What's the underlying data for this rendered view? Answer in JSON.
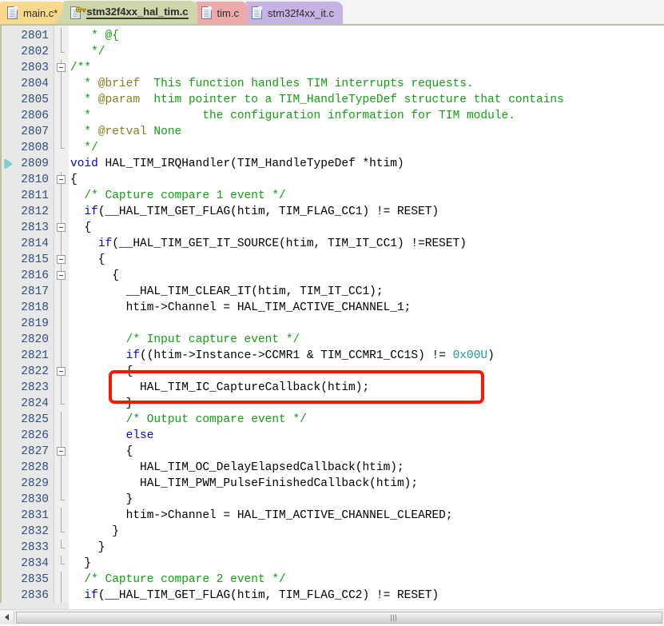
{
  "window": {
    "title": "stm32f4xx_hal_tim.c",
    "accent_green": "#cdd7ab",
    "annotation_color": "#ff1500"
  },
  "tabs": [
    {
      "label": "main.c*",
      "icon": "file-icon",
      "color": "#fbd98c",
      "active": false,
      "modified": true,
      "locked": false
    },
    {
      "label": "stm32f4xx_hal_tim.c",
      "icon": "file-icon",
      "color": "#cdd7ab",
      "active": true,
      "modified": false,
      "locked": true,
      "lock_icon": "key-icon"
    },
    {
      "label": "tim.c",
      "icon": "file-icon",
      "color": "#edaaaa",
      "active": false,
      "modified": false,
      "locked": false
    },
    {
      "label": "stm32f4xx_it.c",
      "icon": "file-icon",
      "color": "#c5b4e3",
      "active": false,
      "modified": false,
      "locked": false
    }
  ],
  "editor": {
    "first_line": 2801,
    "marker_line": 2809,
    "marker_icon": "bookmark-arrow-icon",
    "colors": {
      "keyword": "#0000e6",
      "comment": "#11a011",
      "doxygen_tag": "#8a7a1f",
      "number": "#1b9a9a",
      "text": "#000000",
      "line_number": "#2f4f7f",
      "gutter_bg": "#e8e8e8"
    },
    "lines": [
      {
        "n": 2801,
        "fold": "line",
        "tokens": [
          {
            "t": "   * @{",
            "c": "cmt"
          }
        ]
      },
      {
        "n": 2802,
        "fold": "end",
        "tokens": [
          {
            "t": "   */",
            "c": "cmt"
          }
        ]
      },
      {
        "n": 2803,
        "fold": "box",
        "tokens": [
          {
            "t": "/**",
            "c": "cmt"
          }
        ]
      },
      {
        "n": 2804,
        "fold": "line",
        "tokens": [
          {
            "t": "  * ",
            "c": "cmt"
          },
          {
            "t": "@brief",
            "c": "dox"
          },
          {
            "t": "  This function handles TIM interrupts requests.",
            "c": "cmt"
          }
        ]
      },
      {
        "n": 2805,
        "fold": "line",
        "tokens": [
          {
            "t": "  * ",
            "c": "cmt"
          },
          {
            "t": "@param",
            "c": "dox"
          },
          {
            "t": "  htim pointer to a TIM_HandleTypeDef structure that contains",
            "c": "cmt"
          }
        ]
      },
      {
        "n": 2806,
        "fold": "line",
        "tokens": [
          {
            "t": "  *                the configuration information for TIM module.",
            "c": "cmt"
          }
        ]
      },
      {
        "n": 2807,
        "fold": "line",
        "tokens": [
          {
            "t": "  * ",
            "c": "cmt"
          },
          {
            "t": "@retval",
            "c": "dox"
          },
          {
            "t": " None",
            "c": "cmt"
          }
        ]
      },
      {
        "n": 2808,
        "fold": "end",
        "tokens": [
          {
            "t": "  */",
            "c": "cmt"
          }
        ]
      },
      {
        "n": 2809,
        "fold": "none",
        "marker": true,
        "tokens": [
          {
            "t": "void",
            "c": "kw"
          },
          {
            "t": " HAL_TIM_IRQHandler(TIM_HandleTypeDef *htim)",
            "c": ""
          }
        ]
      },
      {
        "n": 2810,
        "fold": "box",
        "tokens": [
          {
            "t": "{",
            "c": ""
          }
        ]
      },
      {
        "n": 2811,
        "fold": "line",
        "tokens": [
          {
            "t": "  /* Capture compare 1 event */",
            "c": "cmt"
          }
        ]
      },
      {
        "n": 2812,
        "fold": "line",
        "tokens": [
          {
            "t": "  ",
            "c": ""
          },
          {
            "t": "if",
            "c": "kw"
          },
          {
            "t": "(__HAL_TIM_GET_FLAG(htim, TIM_FLAG_CC1) != RESET)",
            "c": ""
          }
        ]
      },
      {
        "n": 2813,
        "fold": "box",
        "tokens": [
          {
            "t": "  {",
            "c": ""
          }
        ]
      },
      {
        "n": 2814,
        "fold": "line",
        "tokens": [
          {
            "t": "    ",
            "c": ""
          },
          {
            "t": "if",
            "c": "kw"
          },
          {
            "t": "(__HAL_TIM_GET_IT_SOURCE(htim, TIM_IT_CC1) !=RESET)",
            "c": ""
          }
        ]
      },
      {
        "n": 2815,
        "fold": "box",
        "tokens": [
          {
            "t": "    {",
            "c": ""
          }
        ]
      },
      {
        "n": 2816,
        "fold": "box",
        "tokens": [
          {
            "t": "      {",
            "c": ""
          }
        ]
      },
      {
        "n": 2817,
        "fold": "line",
        "tokens": [
          {
            "t": "        __HAL_TIM_CLEAR_IT(htim, TIM_IT_CC1);",
            "c": ""
          }
        ]
      },
      {
        "n": 2818,
        "fold": "line",
        "tokens": [
          {
            "t": "        htim->Channel = HAL_TIM_ACTIVE_CHANNEL_1;",
            "c": ""
          }
        ]
      },
      {
        "n": 2819,
        "fold": "line",
        "tokens": [
          {
            "t": "",
            "c": ""
          }
        ]
      },
      {
        "n": 2820,
        "fold": "line",
        "tokens": [
          {
            "t": "        /* Input capture event */",
            "c": "cmt"
          }
        ]
      },
      {
        "n": 2821,
        "fold": "line",
        "tokens": [
          {
            "t": "        ",
            "c": ""
          },
          {
            "t": "if",
            "c": "kw"
          },
          {
            "t": "((htim->Instance->CCMR1 & TIM_CCMR1_CC1S) != ",
            "c": ""
          },
          {
            "t": "0x00U",
            "c": "num"
          },
          {
            "t": ")",
            "c": ""
          }
        ]
      },
      {
        "n": 2822,
        "fold": "box",
        "tokens": [
          {
            "t": "        {",
            "c": ""
          }
        ]
      },
      {
        "n": 2823,
        "fold": "line",
        "tokens": [
          {
            "t": "          HAL_TIM_IC_CaptureCallback(htim);",
            "c": ""
          }
        ]
      },
      {
        "n": 2824,
        "fold": "end",
        "tokens": [
          {
            "t": "        }",
            "c": ""
          }
        ]
      },
      {
        "n": 2825,
        "fold": "line",
        "tokens": [
          {
            "t": "        /* Output compare event */",
            "c": "cmt"
          }
        ]
      },
      {
        "n": 2826,
        "fold": "line",
        "tokens": [
          {
            "t": "        ",
            "c": ""
          },
          {
            "t": "else",
            "c": "kw"
          }
        ]
      },
      {
        "n": 2827,
        "fold": "box",
        "tokens": [
          {
            "t": "        {",
            "c": ""
          }
        ]
      },
      {
        "n": 2828,
        "fold": "line",
        "tokens": [
          {
            "t": "          HAL_TIM_OC_DelayElapsedCallback(htim);",
            "c": ""
          }
        ]
      },
      {
        "n": 2829,
        "fold": "line",
        "tokens": [
          {
            "t": "          HAL_TIM_PWM_PulseFinishedCallback(htim);",
            "c": ""
          }
        ]
      },
      {
        "n": 2830,
        "fold": "end",
        "tokens": [
          {
            "t": "        }",
            "c": ""
          }
        ]
      },
      {
        "n": 2831,
        "fold": "line",
        "tokens": [
          {
            "t": "        htim->Channel = HAL_TIM_ACTIVE_CHANNEL_CLEARED;",
            "c": ""
          }
        ]
      },
      {
        "n": 2832,
        "fold": "end",
        "tokens": [
          {
            "t": "      }",
            "c": ""
          }
        ]
      },
      {
        "n": 2833,
        "fold": "end",
        "tokens": [
          {
            "t": "    }",
            "c": ""
          }
        ]
      },
      {
        "n": 2834,
        "fold": "end",
        "tokens": [
          {
            "t": "  }",
            "c": ""
          }
        ]
      },
      {
        "n": 2835,
        "fold": "line",
        "tokens": [
          {
            "t": "  /* Capture compare 2 event */",
            "c": "cmt"
          }
        ]
      },
      {
        "n": 2836,
        "fold": "line",
        "tokens": [
          {
            "t": "  ",
            "c": ""
          },
          {
            "t": "if",
            "c": "kw"
          },
          {
            "t": "(__HAL_TIM_GET_FLAG(htim, TIM_FLAG_CC2) != RESET)",
            "c": ""
          }
        ]
      }
    ],
    "annotation": {
      "shape": "rounded-rectangle",
      "around_line": 2823,
      "color": "#ff1500"
    }
  },
  "scrollbar": {
    "orientation": "horizontal",
    "left_button_icon": "arrow-left-icon",
    "grip_icon": "grip-icon"
  }
}
